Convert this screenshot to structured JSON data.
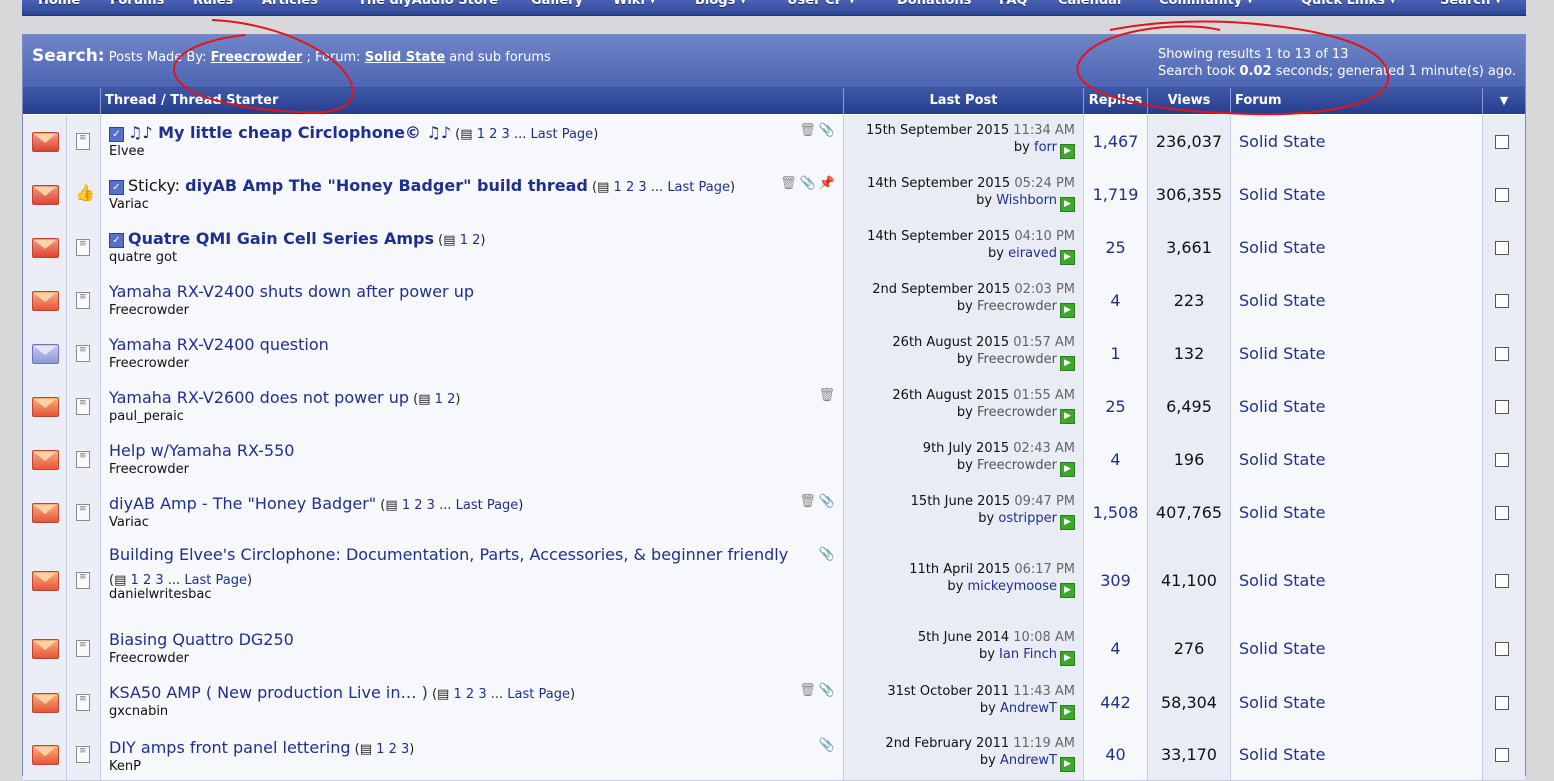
{
  "navbar": [
    {
      "label": "Home"
    },
    {
      "label": "Forums"
    },
    {
      "label": "Rules"
    },
    {
      "label": "Articles"
    },
    {
      "label": "The diyAudio Store"
    },
    {
      "label": "Gallery"
    },
    {
      "label": "Wiki ▾"
    },
    {
      "label": "Blogs ▾"
    },
    {
      "label": "User CP ▾"
    },
    {
      "label": "Donations"
    },
    {
      "label": "FAQ"
    },
    {
      "label": "Calendar"
    },
    {
      "label": "Community ▾"
    },
    {
      "label": "Quick Links ▾"
    },
    {
      "label": "Search ▾"
    }
  ],
  "search": {
    "lead": "Search:",
    "posts_by": "Posts Made By:",
    "user": "Freecrowder",
    "sep": ";",
    "forum_label": "Forum:",
    "forum": "Solid State",
    "sub": "and sub forums",
    "showing": "Showing results 1 to 13 of 13",
    "took_prefix": "Search took",
    "took_value": "0.02",
    "took_suffix": "seconds; generated 1 minute(s) ago."
  },
  "headers": {
    "thread": "Thread / Thread Starter",
    "last_post": "Last Post",
    "replies": "Replies",
    "views": "Views",
    "forum": "Forum",
    "menu_icon": "▼"
  },
  "pages_icon_glyph": "▤",
  "last_page_label": "Last Page",
  "by_label": "by",
  "threads": [
    {
      "title": "♫♪ My little cheap Circlophone© ♫♪",
      "bold": true,
      "subscribed": true,
      "pages": [
        "1",
        "2",
        "3"
      ],
      "last_page": true,
      "starter": "Elvee",
      "tools": [
        "trash-icon",
        "paperclip-icon"
      ],
      "date": "15th September 2015",
      "time": "11:34 AM",
      "user": "forr",
      "replies": "1,467",
      "views": "236,037",
      "forum": "Solid State",
      "icon": "hot"
    },
    {
      "title": "diyAB Amp The \"Honey Badger\" build thread",
      "prefix": "Sticky:",
      "bold": true,
      "subscribed": true,
      "pages": [
        "1",
        "2",
        "3"
      ],
      "last_page": true,
      "starter": "Variac",
      "tools": [
        "trash-icon",
        "paperclip-icon",
        "pin-icon"
      ],
      "date": "14th September 2015",
      "time": "05:24 PM",
      "user": "Wishborn",
      "replies": "1,719",
      "views": "306,355",
      "forum": "Solid State",
      "icon": "hot",
      "thumb": true
    },
    {
      "title": "Quatre QMI Gain Cell Series Amps",
      "bold": true,
      "subscribed": true,
      "pages": [
        "1",
        "2"
      ],
      "last_page": false,
      "starter": "quatre got",
      "tools": [],
      "date": "14th September 2015",
      "time": "04:10 PM",
      "user": "eiraved",
      "replies": "25",
      "views": "3,661",
      "forum": "Solid State",
      "icon": "hot"
    },
    {
      "title": "Yamaha RX-V2400 shuts down after power up",
      "pages": [],
      "starter": "Freecrowder",
      "tools": [],
      "date": "2nd September 2015",
      "time": "02:03 PM",
      "user": "Freecrowder",
      "grey_user": true,
      "replies": "4",
      "views": "223",
      "forum": "Solid State",
      "icon": "new"
    },
    {
      "title": "Yamaha RX-V2400 question",
      "pages": [],
      "starter": "Freecrowder",
      "tools": [],
      "date": "26th August 2015",
      "time": "01:57 AM",
      "user": "Freecrowder",
      "grey_user": true,
      "replies": "1",
      "views": "132",
      "forum": "Solid State",
      "icon": "read"
    },
    {
      "title": "Yamaha RX-V2600 does not power up",
      "pages": [
        "1",
        "2"
      ],
      "last_page": false,
      "starter": "paul_peraic",
      "tools": [
        "trash-icon"
      ],
      "date": "26th August 2015",
      "time": "01:55 AM",
      "user": "Freecrowder",
      "grey_user": true,
      "replies": "25",
      "views": "6,495",
      "forum": "Solid State",
      "icon": "new"
    },
    {
      "title": "Help w/Yamaha RX-550",
      "pages": [],
      "starter": "Freecrowder",
      "tools": [],
      "date": "9th July 2015",
      "time": "02:43 AM",
      "user": "Freecrowder",
      "grey_user": true,
      "replies": "4",
      "views": "196",
      "forum": "Solid State",
      "icon": "new"
    },
    {
      "title": "diyAB Amp - The \"Honey Badger\"",
      "pages": [
        "1",
        "2",
        "3"
      ],
      "last_page": true,
      "starter": "Variac",
      "tools": [
        "trash-icon",
        "paperclip-icon"
      ],
      "date": "15th June 2015",
      "time": "09:47 PM",
      "user": "ostripper",
      "replies": "1,508",
      "views": "407,765",
      "forum": "Solid State",
      "icon": "new"
    },
    {
      "title": "Building Elvee's Circlophone: Documentation, Parts, Accessories, & beginner friendly",
      "pages": [
        "1",
        "2",
        "3"
      ],
      "last_page": true,
      "wrap": true,
      "starter": "danielwritesbac",
      "tools": [
        "paperclip-icon"
      ],
      "date": "11th April 2015",
      "time": "06:17 PM",
      "user": "mickeymoose",
      "replies": "309",
      "views": "41,100",
      "forum": "Solid State",
      "icon": "new"
    },
    {
      "title": "Biasing Quattro DG250",
      "pages": [],
      "starter": "Freecrowder",
      "tools": [],
      "date": "5th June 2014",
      "time": "10:08 AM",
      "user": "Ian Finch",
      "replies": "4",
      "views": "276",
      "forum": "Solid State",
      "icon": "new"
    },
    {
      "title": "KSA50 AMP ( New production Live in… )",
      "pages": [
        "1",
        "2",
        "3"
      ],
      "last_page": true,
      "starter": "gxcnabin",
      "tools": [
        "trash-icon",
        "paperclip-icon"
      ],
      "date": "31st October 2011",
      "time": "11:43 AM",
      "user": "AndrewT",
      "replies": "442",
      "views": "58,304",
      "forum": "Solid State",
      "icon": "new"
    },
    {
      "title": "DIY amps front panel lettering",
      "pages": [
        "1",
        "2",
        "3"
      ],
      "last_page": false,
      "starter": "KenP",
      "tools": [
        "paperclip-icon"
      ],
      "date": "2nd February 2011",
      "time": "11:19 AM",
      "user": "AndrewT",
      "replies": "40",
      "views": "33,170",
      "forum": "Solid State",
      "icon": "new"
    }
  ],
  "colors": {
    "accent": "#2c4593",
    "link": "#1f2f90",
    "annotation": "#e3141b"
  }
}
